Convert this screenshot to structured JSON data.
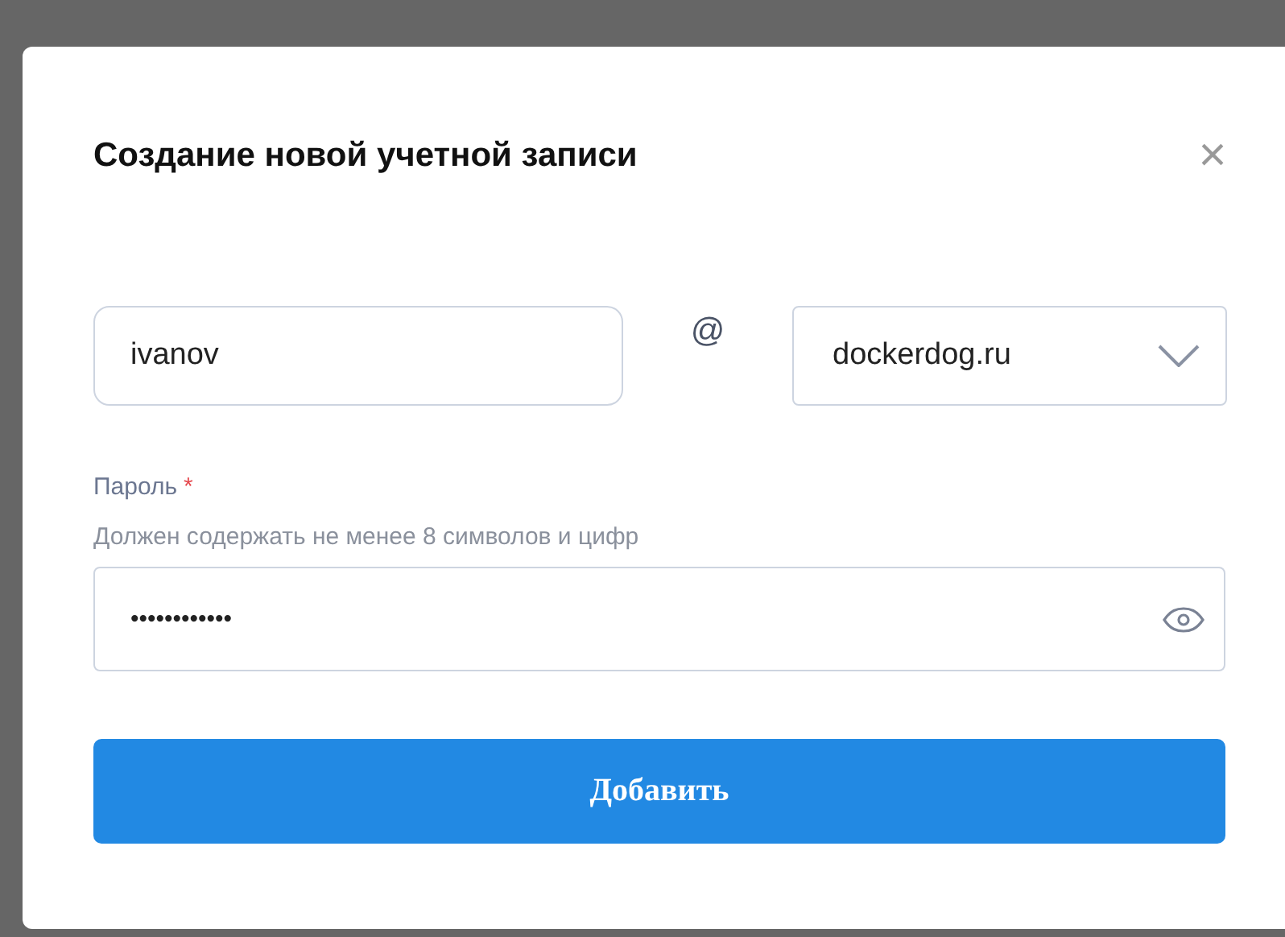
{
  "dialog": {
    "title": "Создание новой учетной записи",
    "close": "×"
  },
  "login": {
    "value": "ivanov"
  },
  "at_sign": "@",
  "domain": {
    "value": "dockerdog.ru"
  },
  "password": {
    "label": "Пароль",
    "required_mark": "*",
    "hint": "Должен содержать не менее 8 символов и цифр",
    "value": "••••••••••••"
  },
  "submit": "Добавить"
}
